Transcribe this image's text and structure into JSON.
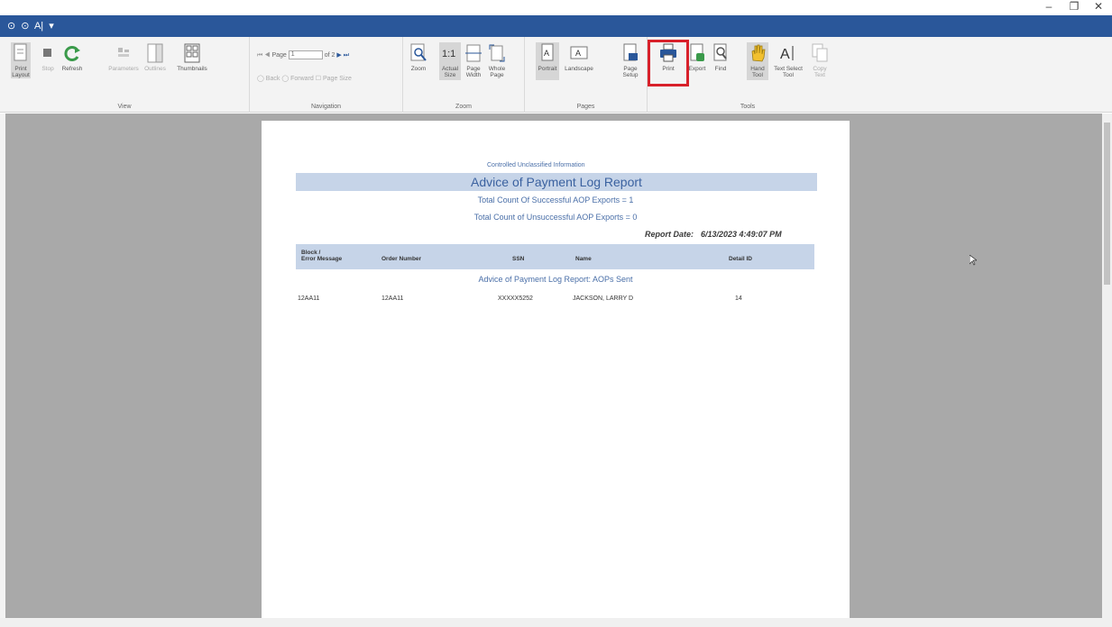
{
  "window": {
    "minimize": "–",
    "restore": "❐",
    "close": "✕"
  },
  "qat": {
    "items": [
      "⊙",
      "⊙",
      "A|",
      "▾"
    ]
  },
  "ribbon": {
    "view_group": {
      "label": "View",
      "print_layout": "Print\nLayout",
      "stop": "Stop",
      "refresh": "Refresh",
      "parameters": "Parameters",
      "outlines": "Outlines",
      "thumbnails": "Thumbnails"
    },
    "navigation_group": {
      "label": "Navigation",
      "page_prefix": "Page",
      "page_value": "1",
      "page_of": "of 2",
      "back": "Back",
      "forward": "Forward",
      "page_size": "Page Size"
    },
    "zoom_group": {
      "label": "Zoom",
      "zoom": "Zoom",
      "actual_size": "Actual\nSize",
      "page_width": "Page\nWidth",
      "whole_page": "Whole\nPage"
    },
    "pages_group": {
      "label": "Pages",
      "portrait": "Portrait",
      "landscape": "Landscape",
      "page_setup": "Page\nSetup"
    },
    "tools_group": {
      "label": "Tools",
      "print": "Print",
      "export": "Export",
      "find": "Find",
      "hand_tool": "Hand\nTool",
      "text_select": "Text Select\nTool",
      "copy_text": "Copy\nText"
    }
  },
  "report": {
    "classification": "Controlled Unclassified Information",
    "title": "Advice of Payment Log Report",
    "count_success": "Total Count Of Successful AOP Exports = 1",
    "count_unsuccess": "Total Count of Unsuccessful AOP Exports = 0",
    "report_date_label": "Report Date:",
    "report_date_value": "6/13/2023 4:49:07 PM",
    "columns": [
      "Block /\nError Message",
      "Order Number",
      "SSN",
      "Name",
      "Detail ID"
    ],
    "section": "Advice of Payment Log Report: AOPs Sent",
    "row": {
      "block": "12AA11",
      "order": "12AA11",
      "ssn": "XXXXX5252",
      "name": "JACKSON, LARRY D",
      "detail": "14"
    }
  }
}
